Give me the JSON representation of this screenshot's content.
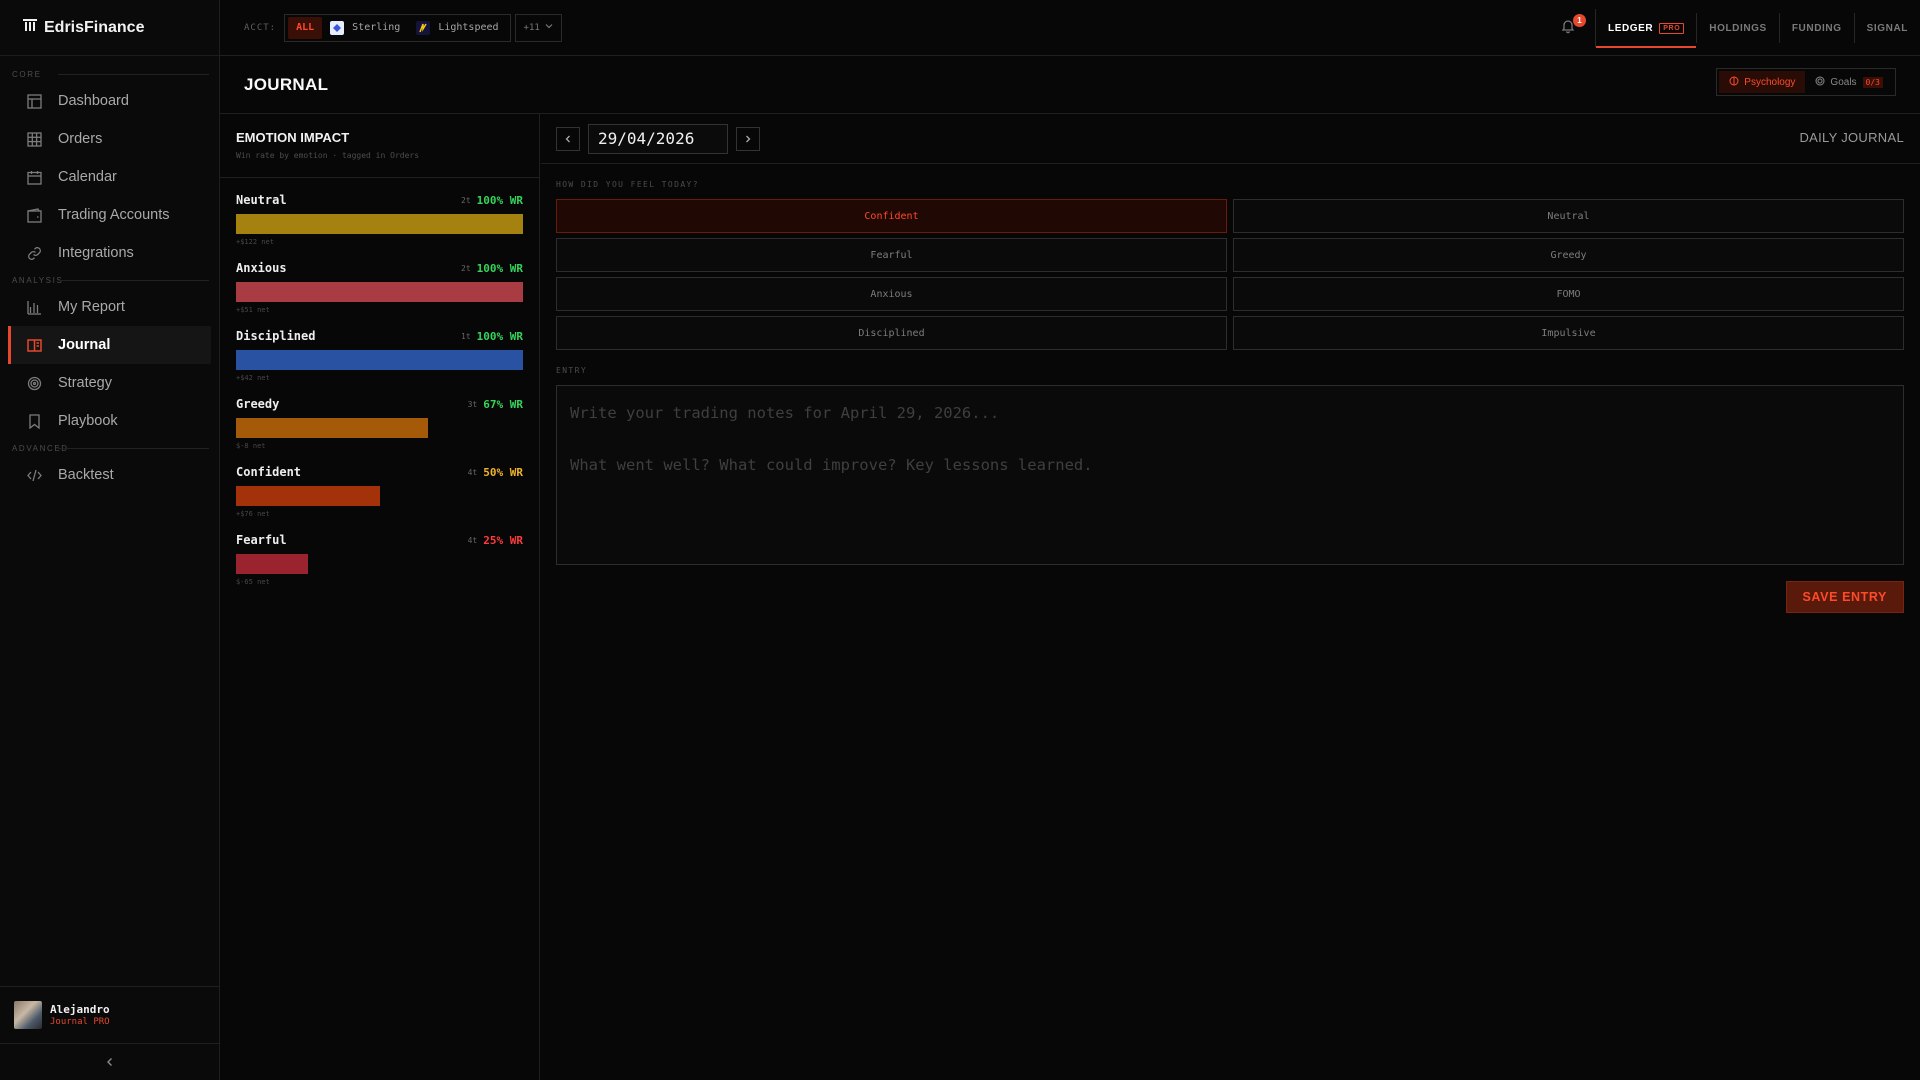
{
  "brand": {
    "name": "EdrisFinance"
  },
  "sidebar": {
    "sections": [
      {
        "label": "CORE",
        "items": [
          {
            "label": "Dashboard",
            "icon": "layout-icon"
          },
          {
            "label": "Orders",
            "icon": "grid-icon"
          },
          {
            "label": "Calendar",
            "icon": "calendar-icon"
          },
          {
            "label": "Trading Accounts",
            "icon": "wallet-icon"
          },
          {
            "label": "Integrations",
            "icon": "link-icon"
          }
        ]
      },
      {
        "label": "ANALYSIS",
        "items": [
          {
            "label": "My Report",
            "icon": "bar-chart-icon"
          },
          {
            "label": "Journal",
            "icon": "book-icon",
            "active": true
          },
          {
            "label": "Strategy",
            "icon": "target-icon"
          },
          {
            "label": "Playbook",
            "icon": "bookmark-icon"
          }
        ]
      },
      {
        "label": "ADVANCED",
        "items": [
          {
            "label": "Backtest",
            "icon": "code-icon"
          }
        ]
      }
    ],
    "user": {
      "name": "Alejandro",
      "plan": "Journal PRO"
    },
    "collapse_icon": "chevron-left-icon"
  },
  "topbar": {
    "acct_label": "ACCT:",
    "accounts": [
      {
        "label": "ALL",
        "active": true
      },
      {
        "label": "Sterling",
        "icon": "sterling-logo-icon"
      },
      {
        "label": "Lightspeed",
        "icon": "lightspeed-logo-icon"
      }
    ],
    "more_label": "+11",
    "notifications_count": "1",
    "tabs": [
      {
        "label": "LEDGER",
        "badge": "PRO",
        "active": true
      },
      {
        "label": "HOLDINGS"
      },
      {
        "label": "FUNDING"
      },
      {
        "label": "SIGNAL"
      }
    ]
  },
  "header": {
    "title": "JOURNAL",
    "toggle": {
      "psychology": "Psychology",
      "goals": "Goals",
      "goals_badge": "0/3"
    }
  },
  "emotion_panel": {
    "title": "EMOTION IMPACT",
    "subtitle": "Win rate by emotion · tagged in Orders",
    "rows": [
      {
        "name": "Neutral",
        "trades": "2t",
        "wr": "100% WR",
        "wr_pct": 100,
        "net": "+$122 net",
        "color": "#a5820f",
        "wr_color": "#35d45a"
      },
      {
        "name": "Anxious",
        "trades": "2t",
        "wr": "100% WR",
        "wr_pct": 100,
        "net": "+$51 net",
        "color": "#a83c42",
        "wr_color": "#35d45a"
      },
      {
        "name": "Disciplined",
        "trades": "1t",
        "wr": "100% WR",
        "wr_pct": 100,
        "net": "+$42 net",
        "color": "#2a52a3",
        "wr_color": "#35d45a"
      },
      {
        "name": "Greedy",
        "trades": "3t",
        "wr": "67% WR",
        "wr_pct": 67,
        "net": "$-8 net",
        "color": "#a55a0a",
        "wr_color": "#35d45a"
      },
      {
        "name": "Confident",
        "trades": "4t",
        "wr": "50% WR",
        "wr_pct": 50,
        "net": "+$76 net",
        "color": "#a3320a",
        "wr_color": "#f0b429"
      },
      {
        "name": "Fearful",
        "trades": "4t",
        "wr": "25% WR",
        "wr_pct": 25,
        "net": "$-65 net",
        "color": "#9a2330",
        "wr_color": "#ff3b3b"
      }
    ]
  },
  "journal": {
    "date": "29/04/2026",
    "daily_label": "DAILY JOURNAL",
    "feel_label": "HOW DID YOU FEEL TODAY?",
    "moods": [
      {
        "label": "Confident",
        "selected": true
      },
      {
        "label": "Neutral"
      },
      {
        "label": "Fearful"
      },
      {
        "label": "Greedy"
      },
      {
        "label": "Anxious"
      },
      {
        "label": "FOMO"
      },
      {
        "label": "Disciplined"
      },
      {
        "label": "Impulsive"
      }
    ],
    "entry_label": "ENTRY",
    "entry_placeholder": "Write your trading notes for April 29, 2026...\n\nWhat went well? What could improve? Key lessons learned.",
    "save_label": "SAVE ENTRY"
  },
  "colors": {
    "accent": "#e5482d",
    "background": "#070707"
  }
}
